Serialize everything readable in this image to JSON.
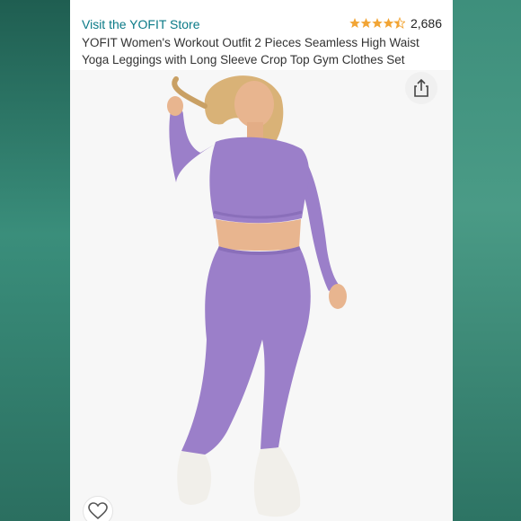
{
  "store": {
    "link_text": "Visit the YOFIT Store"
  },
  "rating": {
    "value": 4.5,
    "count": "2,686",
    "star_color": "#f2a535"
  },
  "product": {
    "title": "YOFIT Women's Workout Outfit 2 Pieces Seamless High Waist Yoga Leggings with Long Sleeve Crop Top Gym Clothes Set",
    "garment_color": "#9b7fc9"
  },
  "icons": {
    "share": "share-icon",
    "favorite": "heart-icon"
  }
}
